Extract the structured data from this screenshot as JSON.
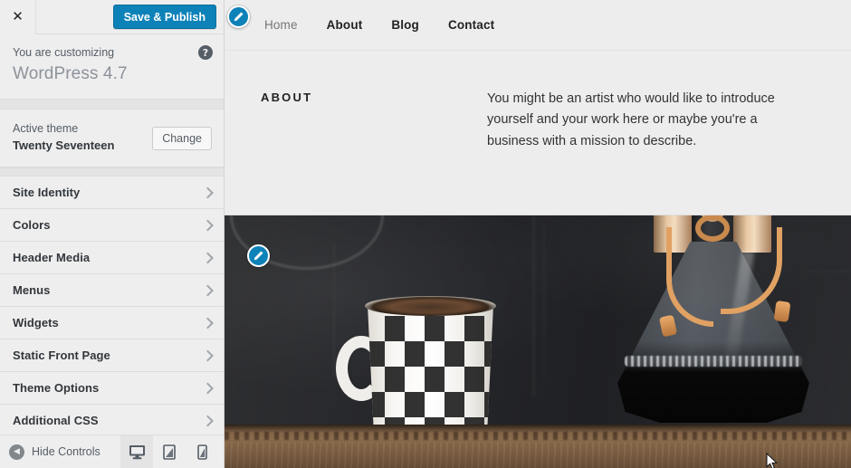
{
  "sidebar": {
    "close_label": "✕",
    "save_button": "Save & Publish",
    "customizing": {
      "label": "You are customizing",
      "title": "WordPress 4.7",
      "help_icon": "help-icon",
      "help_glyph": "?"
    },
    "theme": {
      "label": "Active theme",
      "name": "Twenty Seventeen",
      "change_button": "Change"
    },
    "items": [
      {
        "label": "Site Identity"
      },
      {
        "label": "Colors"
      },
      {
        "label": "Header Media"
      },
      {
        "label": "Menus"
      },
      {
        "label": "Widgets"
      },
      {
        "label": "Static Front Page"
      },
      {
        "label": "Theme Options"
      },
      {
        "label": "Additional CSS"
      }
    ],
    "footer": {
      "hide_controls": "Hide Controls",
      "collapse_glyph": "◀",
      "devices": [
        {
          "name": "desktop-preview-button",
          "active": true
        },
        {
          "name": "tablet-preview-button",
          "active": false
        },
        {
          "name": "mobile-preview-button",
          "active": false
        }
      ]
    }
  },
  "preview": {
    "nav": [
      {
        "label": "Home",
        "style": "muted"
      },
      {
        "label": "About",
        "style": "strong"
      },
      {
        "label": "Blog",
        "style": "strong"
      },
      {
        "label": "Contact",
        "style": "strong"
      }
    ],
    "section": {
      "heading": "ABOUT",
      "body": "You might be an artist who would like to introduce yourself and your work here or maybe you're a business with a mission to describe."
    },
    "hero": {
      "alt": "Black and white harlequin patterned mug beside a glass Chemex coffee brewer on a wooden table against a dark chalkboard wall"
    },
    "edit_icons": [
      {
        "name": "edit-shortcut-nav-icon"
      },
      {
        "name": "edit-shortcut-header-image-icon"
      }
    ]
  },
  "colors": {
    "accent_blue": "#0d82b8",
    "sidebar_bg": "#eeeeee",
    "sidebar_border": "#dddddd",
    "text_dark": "#32373c",
    "text_muted": "#555d66",
    "preview_bg": "#ededed"
  }
}
